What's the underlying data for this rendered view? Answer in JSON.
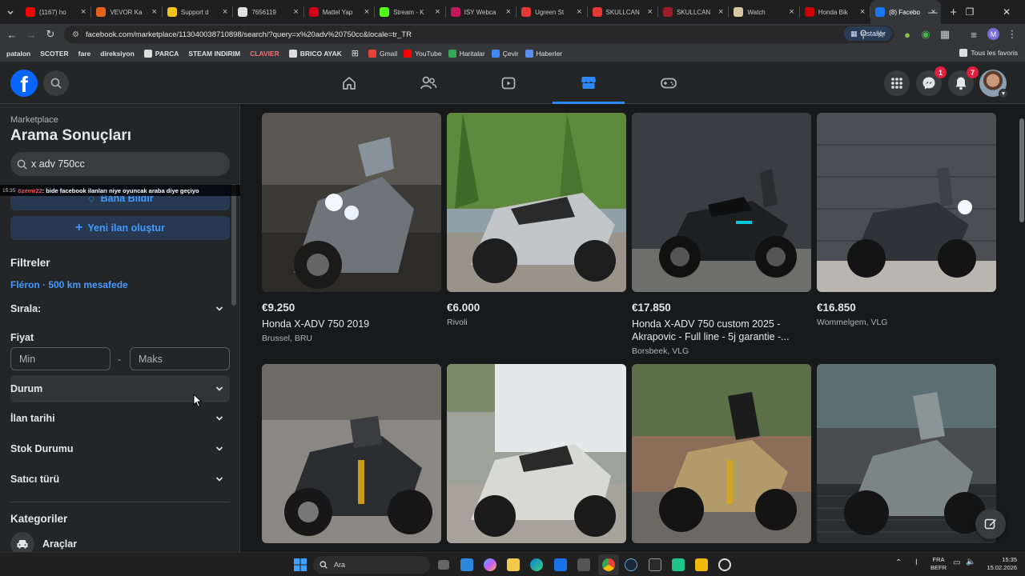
{
  "browser": {
    "tabs": [
      {
        "title": "(1167) ho",
        "color": "#ff0000"
      },
      {
        "title": "VEVOR Ka",
        "color": "#e8611c"
      },
      {
        "title": "Support d",
        "color": "#f0c419"
      },
      {
        "title": "7656119",
        "color": "#e0e0e0"
      },
      {
        "title": "Mattel Yap",
        "color": "#d0021b"
      },
      {
        "title": "Stream - K",
        "color": "#53fc18"
      },
      {
        "title": "ISY Webca",
        "color": "#c2185b"
      },
      {
        "title": "Ugreen St",
        "color": "#e53935"
      },
      {
        "title": "SKULLCAN",
        "color": "#e53935"
      },
      {
        "title": "SKULLCAN",
        "color": "#9c1c2c"
      },
      {
        "title": "Watch",
        "color": "#d7c9a6"
      },
      {
        "title": "Honda Bik",
        "color": "#cc0000"
      },
      {
        "title": "(8) Facebo",
        "color": "#1877f2",
        "active": true
      }
    ],
    "url": "facebook.com/marketplace/113040038710898/search/?query=x%20adv%20750cc&locale=tr_TR",
    "install_label": "Installer",
    "bookmarks": [
      "patalon",
      "SCOTER",
      "fare",
      "direksiyon",
      "PARCA",
      "STEAM INDIRIM",
      "CLAVIER",
      "BRICO AYAK",
      "Gmail",
      "YouTube",
      "Haritalar",
      "Çevir",
      "Haberler"
    ],
    "favorites_label": "Tous les favoris"
  },
  "header": {
    "logo_letter": "f",
    "messenger_badge": "1",
    "notifications_badge": "7"
  },
  "sidebar": {
    "section_label": "Marketplace",
    "title": "Arama Sonuçları",
    "search_value": "x adv 750cc",
    "notify_label": "Bana Bildir",
    "new_listing_label": "Yeni ilan oluştur",
    "filters_heading": "Filtreler",
    "location": "Fléron · 500 km mesafede",
    "sort_label": "Sırala:",
    "price_heading": "Fiyat",
    "price_min_placeholder": "Min",
    "price_dash": "-",
    "price_max_placeholder": "Maks",
    "filter_rows": [
      "Durum",
      "İlan tarihi",
      "Stok Durumu",
      "Satıcı türü"
    ],
    "categories_heading": "Kategoriler",
    "category_first": "Araçlar"
  },
  "chat_overlay": {
    "time": "15:35",
    "user": "özemr22",
    "message": ": bide facebook ilanları niye oyuncak araba diye geçiyo"
  },
  "listings": [
    {
      "price": "€9.250",
      "title": "Honda X-ADV 750 2019",
      "location": "Brussel, BRU"
    },
    {
      "price": "€6.000",
      "title": "",
      "location": "Rivoli"
    },
    {
      "price": "€17.850",
      "title": "Honda X-ADV 750 custom 2025 - Akrapovic - Full line - 5j garantie -...",
      "location": "Borsbeek, VLG"
    },
    {
      "price": "€16.850",
      "title": "",
      "location": "Wommelgem, VLG"
    },
    {
      "price": "",
      "title": "",
      "location": ""
    },
    {
      "price": "",
      "title": "",
      "location": ""
    },
    {
      "price": "",
      "title": "",
      "location": ""
    },
    {
      "price": "",
      "title": "",
      "location": ""
    }
  ],
  "taskbar": {
    "search_placeholder": "Ara",
    "lang_top": "FRA",
    "lang_bottom": "BEFR",
    "time": "15:35",
    "date": "15.02.2026"
  }
}
